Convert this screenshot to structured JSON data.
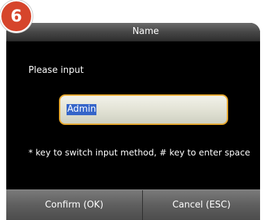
{
  "step_badge": "6",
  "dialog": {
    "title": "Name",
    "prompt": "Please input",
    "input_value": "Admin",
    "hint": "* key to switch input method, # key to enter space"
  },
  "buttons": {
    "confirm_label": "Confirm (OK)",
    "cancel_label": "Cancel (ESC)"
  },
  "colors": {
    "badge": "#d6452b",
    "input_border": "#e8a92e",
    "selection": "#3565c9"
  }
}
